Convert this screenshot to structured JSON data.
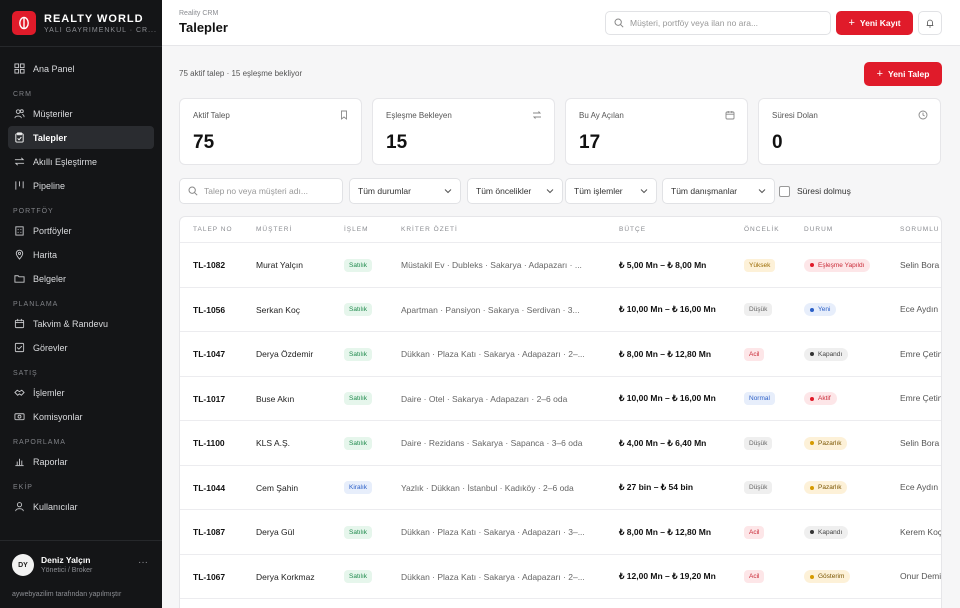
{
  "sidebar": {
    "brand_title": "REALTY WORLD",
    "brand_subtitle": "YALI GAYRIMENKUL · CR...",
    "items": [
      {
        "type": "item",
        "label": "Ana Panel",
        "icon": "grid-icon"
      },
      {
        "type": "section",
        "label": "CRM"
      },
      {
        "type": "item",
        "label": "Müşteriler",
        "icon": "users-icon"
      },
      {
        "type": "item",
        "label": "Talepler",
        "icon": "clipboard-icon",
        "active": true
      },
      {
        "type": "item",
        "label": "Akıllı Eşleştirme",
        "icon": "swap-icon"
      },
      {
        "type": "item",
        "label": "Pipeline",
        "icon": "columns-icon"
      },
      {
        "type": "section",
        "label": "PORTFÖY"
      },
      {
        "type": "item",
        "label": "Portföyler",
        "icon": "building-icon"
      },
      {
        "type": "item",
        "label": "Harita",
        "icon": "map-pin-icon"
      },
      {
        "type": "item",
        "label": "Belgeler",
        "icon": "folder-icon"
      },
      {
        "type": "section",
        "label": "PLANLAMA"
      },
      {
        "type": "item",
        "label": "Takvim & Randevu",
        "icon": "calendar-icon"
      },
      {
        "type": "item",
        "label": "Görevler",
        "icon": "checklist-icon"
      },
      {
        "type": "section",
        "label": "SATIŞ"
      },
      {
        "type": "item",
        "label": "İşlemler",
        "icon": "handshake-icon"
      },
      {
        "type": "item",
        "label": "Komisyonlar",
        "icon": "cash-icon"
      },
      {
        "type": "section",
        "label": "RAPORLAMA"
      },
      {
        "type": "item",
        "label": "Raporlar",
        "icon": "bar-chart-icon"
      },
      {
        "type": "section",
        "label": "EKİP"
      },
      {
        "type": "item",
        "label": "Kullanıcılar",
        "icon": "user-icon"
      }
    ],
    "user": {
      "initials": "DY",
      "name": "Deniz Yalçın",
      "role": "Yönetici / Broker",
      "more": "···"
    },
    "credit": "aywebyazilim tarafından yapılmıştır"
  },
  "header": {
    "breadcrumb": "Reality CRM",
    "title": "Talepler",
    "search_placeholder": "Müşteri, portföy veya ilan no ara...",
    "new_record_label": "Yeni Kayıt"
  },
  "summary": "75 aktif talep · 15 eşleşme bekliyor",
  "new_request_label": "Yeni Talep",
  "cards": [
    {
      "label": "Aktif Talep",
      "value": "75",
      "icon": "bookmark-icon"
    },
    {
      "label": "Eşleşme Bekleyen",
      "value": "15",
      "icon": "swap-icon"
    },
    {
      "label": "Bu Ay Açılan",
      "value": "17",
      "icon": "calendar-icon"
    },
    {
      "label": "Süresi Dolan",
      "value": "0",
      "icon": "clock-icon"
    }
  ],
  "filters": {
    "search_placeholder": "Talep no veya müşteri adı...",
    "status": "Tüm durumlar",
    "priority": "Tüm öncelikler",
    "transaction": "Tüm işlemler",
    "consultant": "Tüm danışmanlar",
    "expired_label": "Süresi dolmuş"
  },
  "table": {
    "columns": [
      "TALEP NO",
      "MÜŞTERİ",
      "İŞLEM",
      "KRİTER ÖZETİ",
      "BÜTÇE",
      "ÖNCELİK",
      "DURUM",
      "SORUMLU"
    ],
    "rows": [
      {
        "id": "TL-1082",
        "musteri": "Murat Yalçın",
        "islem": "Satılık",
        "islem_kind": "satilik",
        "kriter": "Müstakil Ev · Dubleks · Sakarya · Adapazarı · ...",
        "butce": "₺ 5,00 Mn – ₺ 8,00 Mn",
        "oncelik": "Yüksek",
        "oncelik_kind": "yuksek",
        "durum": "Eşleşme Yapıldı",
        "durum_kind": "red",
        "sorumlu": "Selin Bora"
      },
      {
        "id": "TL-1056",
        "musteri": "Serkan Koç",
        "islem": "Satılık",
        "islem_kind": "satilik",
        "kriter": "Apartman · Pansiyon · Sakarya · Serdivan · 3...",
        "butce": "₺ 10,00 Mn – ₺ 16,00 Mn",
        "oncelik": "Düşük",
        "oncelik_kind": "dusuk",
        "durum": "Yeni",
        "durum_kind": "blue",
        "sorumlu": "Ece Aydın"
      },
      {
        "id": "TL-1047",
        "musteri": "Derya Özdemir",
        "islem": "Satılık",
        "islem_kind": "satilik",
        "kriter": "Dükkan · Plaza Katı · Sakarya · Adapazarı · 2–...",
        "butce": "₺ 8,00 Mn – ₺ 12,80 Mn",
        "oncelik": "Acil",
        "oncelik_kind": "acil",
        "durum": "Kapandı",
        "durum_kind": "gray",
        "sorumlu": "Emre Çetin"
      },
      {
        "id": "TL-1017",
        "musteri": "Buse Akın",
        "islem": "Satılık",
        "islem_kind": "satilik",
        "kriter": "Daire · Otel · Sakarya · Adapazarı · 2–6 oda",
        "butce": "₺ 10,00 Mn – ₺ 16,00 Mn",
        "oncelik": "Normal",
        "oncelik_kind": "normal",
        "durum": "Aktif",
        "durum_kind": "red",
        "sorumlu": "Emre Çetin"
      },
      {
        "id": "TL-1100",
        "musteri": "KLS A.Ş.",
        "islem": "Satılık",
        "islem_kind": "satilik",
        "kriter": "Daire · Rezidans · Sakarya · Sapanca · 3–6 oda",
        "butce": "₺ 4,00 Mn – ₺ 6,40 Mn",
        "oncelik": "Düşük",
        "oncelik_kind": "dusuk",
        "durum": "Pazarlık",
        "durum_kind": "yellow",
        "sorumlu": "Selin Bora"
      },
      {
        "id": "TL-1044",
        "musteri": "Cem Şahin",
        "islem": "Kiralık",
        "islem_kind": "kiralik",
        "kriter": "Yazlık · Dükkan · İstanbul · Kadıköy · 2–6 oda",
        "butce": "₺ 27 bin – ₺ 54 bin",
        "oncelik": "Düşük",
        "oncelik_kind": "dusuk",
        "durum": "Pazarlık",
        "durum_kind": "yellow",
        "sorumlu": "Ece Aydın"
      },
      {
        "id": "TL-1087",
        "musteri": "Derya Gül",
        "islem": "Satılık",
        "islem_kind": "satilik",
        "kriter": "Dükkan · Plaza Katı · Sakarya · Adapazarı · 3–...",
        "butce": "₺ 8,00 Mn – ₺ 12,80 Mn",
        "oncelik": "Acil",
        "oncelik_kind": "acil",
        "durum": "Kapandı",
        "durum_kind": "gray",
        "sorumlu": "Kerem Koç"
      },
      {
        "id": "TL-1067",
        "musteri": "Derya Korkmaz",
        "islem": "Satılık",
        "islem_kind": "satilik",
        "kriter": "Dükkan · Plaza Katı · Sakarya · Adapazarı · 2–...",
        "butce": "₺ 12,00 Mn – ₺ 19,20 Mn",
        "oncelik": "Acil",
        "oncelik_kind": "acil",
        "durum": "Gösterim",
        "durum_kind": "yellow",
        "sorumlu": "Onur Demir"
      }
    ]
  },
  "colors": {
    "accent": "#e01b2a",
    "sidebar_bg": "#141517",
    "page_bg": "#f6f6f7"
  }
}
